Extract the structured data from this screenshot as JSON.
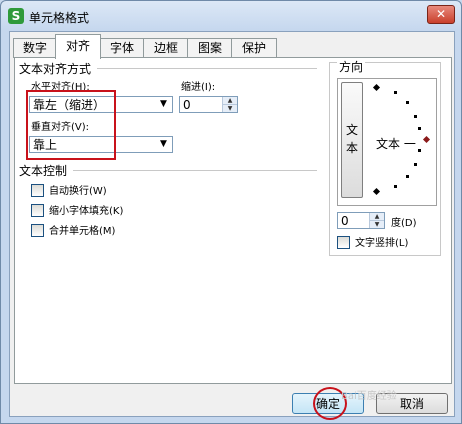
{
  "window": {
    "title": "单元格格式",
    "app_icon_glyph": "S",
    "close_glyph": "✕"
  },
  "tabs": [
    "数字",
    "对齐",
    "字体",
    "边框",
    "图案",
    "保护"
  ],
  "active_tab": "对齐",
  "text_align": {
    "section": "文本对齐方式",
    "horizontal_label": "水平对齐(H):",
    "horizontal_value": "靠左（缩进）",
    "indent_label": "缩进(I):",
    "indent_value": "0",
    "vertical_label": "垂直对齐(V):",
    "vertical_value": "靠上"
  },
  "text_control": {
    "section": "文本控制",
    "options": [
      {
        "label": "自动换行(W)",
        "checked": false
      },
      {
        "label": "缩小字体填充(K)",
        "checked": false
      },
      {
        "label": "合并单元格(M)",
        "checked": false
      }
    ]
  },
  "orientation": {
    "section": "方向",
    "vertical_text": "文\n本",
    "text_label": "文本 一",
    "degree_value": "0",
    "degree_label": "度(D)",
    "vertical_layout_label": "文字竖排(L)"
  },
  "buttons": {
    "ok": "确定",
    "cancel": "取消"
  },
  "watermark": "Bai百度经验",
  "colors": {
    "highlight": "#c8121b",
    "title_bg": "#c5d7ee"
  }
}
